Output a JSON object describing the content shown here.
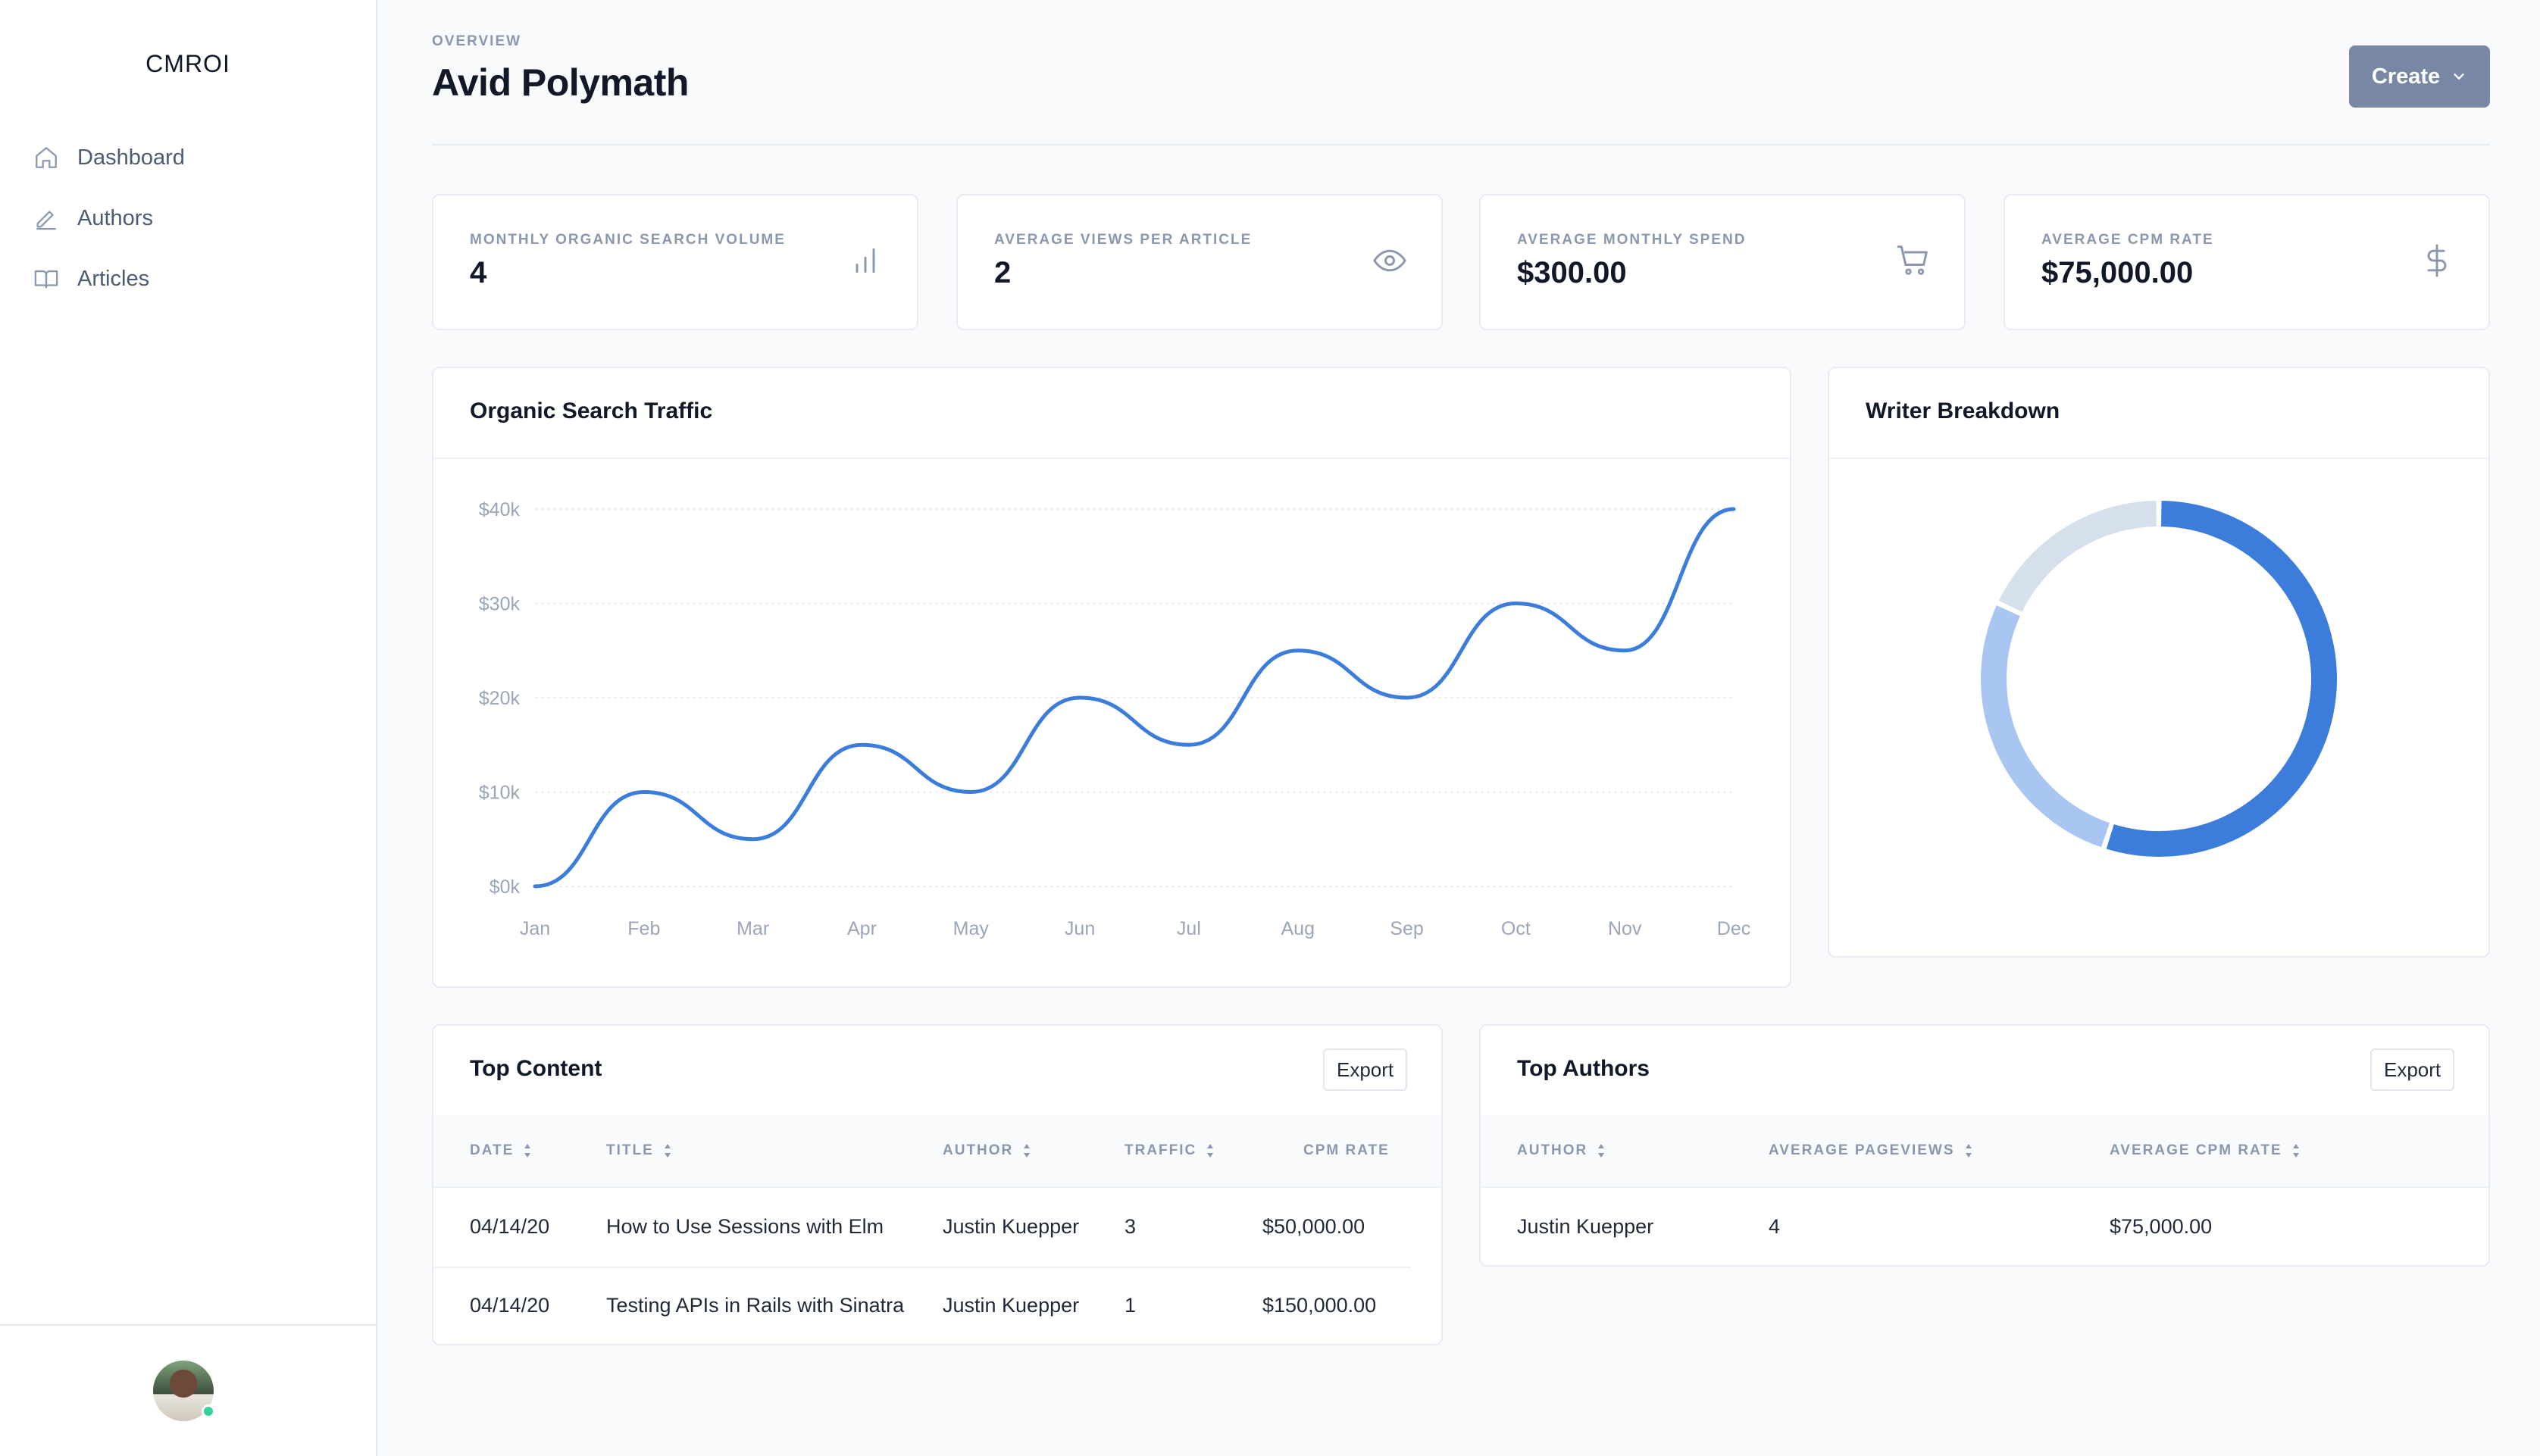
{
  "sidebar": {
    "brand": "CMROI",
    "items": [
      {
        "label": "Dashboard",
        "icon": "home-icon"
      },
      {
        "label": "Authors",
        "icon": "pencil-icon"
      },
      {
        "label": "Articles",
        "icon": "book-icon"
      }
    ]
  },
  "header": {
    "eyebrow": "OVERVIEW",
    "title": "Avid Polymath",
    "create_label": "Create"
  },
  "stats": [
    {
      "label": "Monthly Organic Search Volume",
      "value": "4",
      "icon": "bar-chart-icon"
    },
    {
      "label": "Average Views Per Article",
      "value": "2",
      "icon": "eye-icon"
    },
    {
      "label": "Average Monthly Spend",
      "value": "$300.00",
      "icon": "cart-icon"
    },
    {
      "label": "Average CPM Rate",
      "value": "$75,000.00",
      "icon": "dollar-icon"
    }
  ],
  "traffic": {
    "title": "Organic Search Traffic"
  },
  "writer": {
    "title": "Writer Breakdown"
  },
  "chart_data": [
    {
      "type": "line",
      "title": "Organic Search Traffic",
      "categories": [
        "Jan",
        "Feb",
        "Mar",
        "Apr",
        "May",
        "Jun",
        "Jul",
        "Aug",
        "Sep",
        "Oct",
        "Nov",
        "Dec"
      ],
      "values": [
        0,
        10000,
        5000,
        15000,
        10000,
        20000,
        15000,
        25000,
        20000,
        30000,
        25000,
        40000
      ],
      "ylim": [
        0,
        40000
      ],
      "yticks": [
        0,
        10000,
        20000,
        30000,
        40000
      ],
      "ytick_labels": [
        "$0k",
        "$10k",
        "$20k",
        "$30k",
        "$40k"
      ],
      "grid": true,
      "color": "#3c7ddb"
    },
    {
      "type": "pie",
      "title": "Writer Breakdown",
      "donut": true,
      "values": [
        55,
        27,
        18
      ],
      "colors": [
        "#3c7ddb",
        "#a9c6f2",
        "#d6dfec"
      ]
    }
  ],
  "top_content": {
    "title": "Top Content",
    "export_label": "Export",
    "columns": [
      "DATE",
      "TITLE",
      "AUTHOR",
      "TRAFFIC",
      "CPM RATE"
    ],
    "rows": [
      [
        "04/14/20",
        "How to Use Sessions with Elm",
        "Justin Kuepper",
        "3",
        "$50,000.00"
      ],
      [
        "04/14/20",
        "Testing APIs in Rails with Sinatra",
        "Justin Kuepper",
        "1",
        "$150,000.00"
      ]
    ]
  },
  "top_authors": {
    "title": "Top Authors",
    "export_label": "Export",
    "columns": [
      "AUTHOR",
      "AVERAGE PAGEVIEWS",
      "AVERAGE CPM RATE"
    ],
    "rows": [
      [
        "Justin Kuepper",
        "4",
        "$75,000.00"
      ]
    ]
  },
  "colors": {
    "accent": "#3c7ddb",
    "muted": "#8a97ad",
    "button": "#7887a3"
  }
}
